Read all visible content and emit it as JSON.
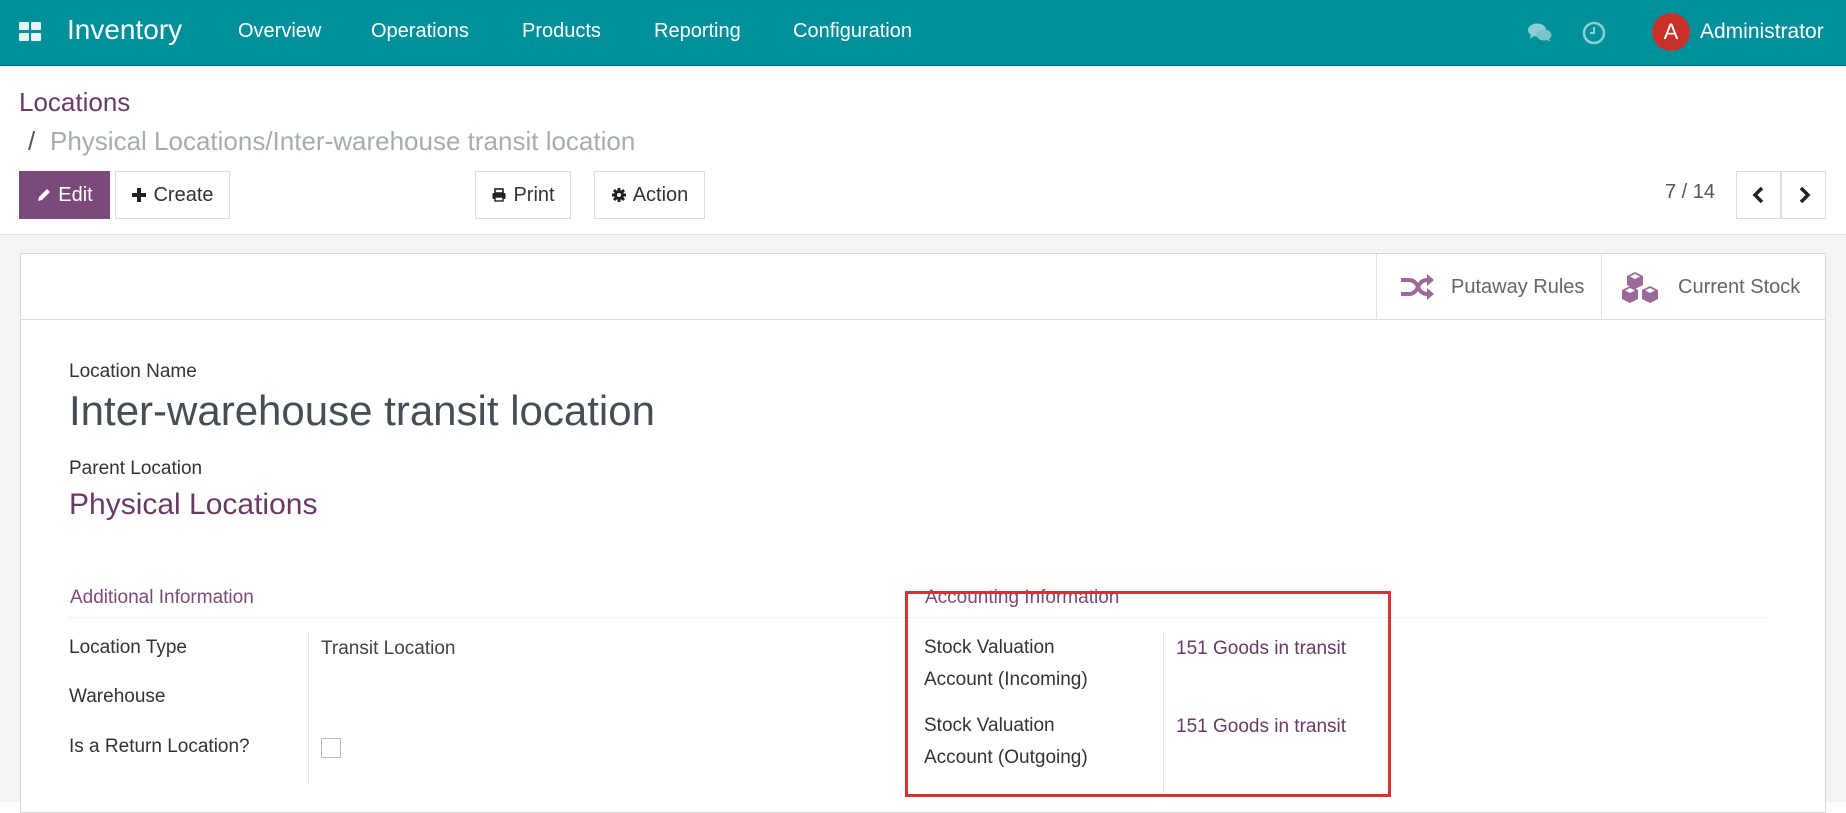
{
  "navbar": {
    "app_name": "Inventory",
    "menu": [
      "Overview",
      "Operations",
      "Products",
      "Reporting",
      "Configuration"
    ],
    "icons": {
      "apps": "apps-grid-icon",
      "chat": "chat-icon",
      "activity": "clock-icon"
    },
    "avatar_letter": "A",
    "user_name": "Administrator",
    "colors": {
      "bar": "#00909b",
      "avatar": "#c8302a"
    }
  },
  "breadcrumb": {
    "root": "Locations",
    "separator": "/",
    "current": "Physical Locations/Inter-warehouse transit location"
  },
  "toolbar": {
    "edit_label": "Edit",
    "create_label": "Create",
    "print_label": "Print",
    "action_label": "Action",
    "pager": "7 / 14",
    "colors": {
      "primary": "#7c4a7a"
    }
  },
  "smart_buttons": [
    {
      "label": "Putaway Rules",
      "icon": "shuffle-icon"
    },
    {
      "label": "Current Stock",
      "icon": "cubes-icon"
    }
  ],
  "form": {
    "name_label": "Location Name",
    "name_value": "Inter-warehouse transit location",
    "parent_label": "Parent Location",
    "parent_value": "Physical Locations",
    "additional": {
      "title": "Additional Information",
      "fields": [
        {
          "label": "Location Type",
          "value": "Transit Location"
        },
        {
          "label": "Warehouse",
          "value": ""
        },
        {
          "label": "Is a Return Location?",
          "value": false
        }
      ]
    },
    "accounting": {
      "title": "Accounting Information",
      "fields": [
        {
          "label_line1": "Stock Valuation",
          "label_line2": "Account (Incoming)",
          "value": "151 Goods in transit"
        },
        {
          "label_line1": "Stock Valuation",
          "label_line2": "Account (Outgoing)",
          "value": "151 Goods in transit"
        }
      ],
      "highlight_color": "#d73333"
    }
  }
}
